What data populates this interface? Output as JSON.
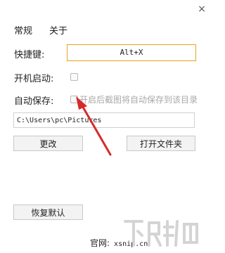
{
  "window": {
    "close_glyph": "×"
  },
  "tabs": [
    {
      "label": "常规"
    },
    {
      "label": "关于"
    }
  ],
  "hotkey": {
    "label": "快捷键:",
    "value": "Alt+X"
  },
  "startup": {
    "label": "开机启动:"
  },
  "autosave": {
    "label": "自动保存:",
    "option_text": "开启后截图将自动保存到该目录"
  },
  "save_path": {
    "value": "C:\\Users\\pc\\Pictures"
  },
  "buttons": {
    "change": "更改",
    "open_folder": "打开文件夹",
    "restore_default": "恢复默认"
  },
  "footer": {
    "label": "官网:",
    "site": "xsnip.cn"
  },
  "colors": {
    "accent": "#e8a318",
    "arrow": "#d62b2b",
    "disabled_text": "#a9a9a9",
    "watermark": "#cfcfcf"
  },
  "icons": [
    "close-icon",
    "checkbox-icon",
    "arrow-annotation"
  ]
}
